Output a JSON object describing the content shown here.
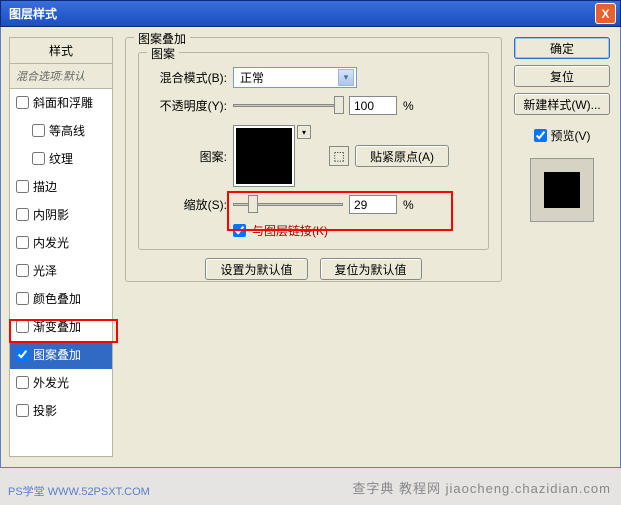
{
  "title": "图层样式",
  "close_icon": "X",
  "left": {
    "header": "样式",
    "subheader": "混合选项:默认",
    "items": [
      {
        "label": "斜面和浮雕",
        "checked": false,
        "indent": false
      },
      {
        "label": "等高线",
        "checked": false,
        "indent": true
      },
      {
        "label": "纹理",
        "checked": false,
        "indent": true
      },
      {
        "label": "描边",
        "checked": false,
        "indent": false
      },
      {
        "label": "内阴影",
        "checked": false,
        "indent": false
      },
      {
        "label": "内发光",
        "checked": false,
        "indent": false
      },
      {
        "label": "光泽",
        "checked": false,
        "indent": false
      },
      {
        "label": "颜色叠加",
        "checked": false,
        "indent": false
      },
      {
        "label": "渐变叠加",
        "checked": false,
        "indent": false
      },
      {
        "label": "图案叠加",
        "checked": true,
        "indent": false,
        "selected": true
      },
      {
        "label": "外发光",
        "checked": false,
        "indent": false
      },
      {
        "label": "投影",
        "checked": false,
        "indent": false
      }
    ]
  },
  "center": {
    "group_outer": "图案叠加",
    "group_inner": "图案",
    "blend_mode_label": "混合模式(B):",
    "blend_mode_value": "正常",
    "opacity_label": "不透明度(Y):",
    "opacity_value": "100",
    "percent": "%",
    "pattern_label": "图案:",
    "snap_origin": "贴紧原点(A)",
    "scale_label": "缩放(S):",
    "scale_value": "29",
    "link_layer": "与图层链接(K)",
    "link_checked": true,
    "make_default": "设置为默认值",
    "reset_default": "复位为默认值",
    "snap_icon": "⬚"
  },
  "right": {
    "ok": "确定",
    "cancel": "复位",
    "new_style": "新建样式(W)...",
    "preview_label": "预览(V)",
    "preview_checked": true
  },
  "watermark_left": "PS学堂 WWW.52PSXT.COM",
  "watermark_right": "查字典 教程网  jiaocheng.chazidian.com"
}
